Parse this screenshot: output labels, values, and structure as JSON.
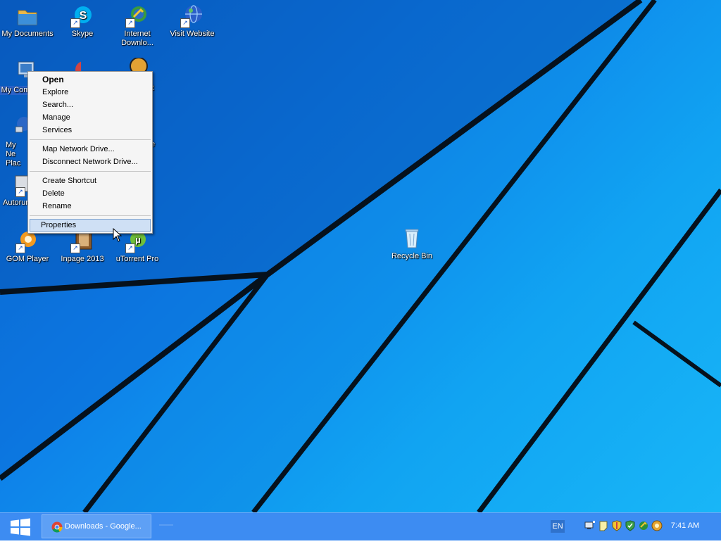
{
  "desktop": {
    "icons": [
      {
        "id": "my-documents",
        "label": "My Documents",
        "shortcut": false
      },
      {
        "id": "skype",
        "label": "Skype",
        "shortcut": true
      },
      {
        "id": "internet-download",
        "label": "Internet Downlo...",
        "shortcut": true
      },
      {
        "id": "visit-website",
        "label": "Visit Website",
        "shortcut": true
      },
      {
        "id": "my-computer",
        "label": "My Com",
        "shortcut": false
      },
      {
        "id": "my-network",
        "label": "My Ne Plac",
        "shortcut": false
      },
      {
        "id": "autorun",
        "label": "Autorun",
        "shortcut": true
      },
      {
        "id": "gom-player",
        "label": "GOM Player",
        "shortcut": true
      },
      {
        "id": "inpage",
        "label": "Inpage 2013",
        "shortcut": true
      },
      {
        "id": "utorrent",
        "label": "uTorrent Pro",
        "shortcut": true
      },
      {
        "id": "recycle-bin",
        "label": "Recycle Bin",
        "shortcut": false
      }
    ],
    "partial_labels": {
      "row2_right": "st",
      "row3_right": "e"
    }
  },
  "context_menu": {
    "items": [
      {
        "label": "Open",
        "bold": true
      },
      {
        "label": "Explore"
      },
      {
        "label": "Search..."
      },
      {
        "label": "Manage"
      },
      {
        "label": "Services"
      },
      {
        "separator": true
      },
      {
        "label": "Map Network Drive..."
      },
      {
        "label": "Disconnect Network Drive..."
      },
      {
        "separator": true
      },
      {
        "label": "Create Shortcut"
      },
      {
        "label": "Delete"
      },
      {
        "label": "Rename"
      },
      {
        "separator": true
      },
      {
        "label": "Properties",
        "highlighted": true
      }
    ]
  },
  "taskbar": {
    "start_icon": "windows-logo-icon",
    "active_task": {
      "label": "Downloads - Google...",
      "icon": "chrome-icon"
    },
    "language": "EN",
    "tray_icons": [
      "network-icon",
      "notes-icon",
      "shield-icon",
      "antivirus-icon",
      "internet-download-tray-icon",
      "gom-tray-icon"
    ],
    "clock": "7:41 AM"
  },
  "colors": {
    "taskbar": "#3d8cf2",
    "menu_highlight": "#cfe0f5",
    "wallpaper_dark": "#0a5fc4",
    "wallpaper_light": "#18b6f7"
  }
}
